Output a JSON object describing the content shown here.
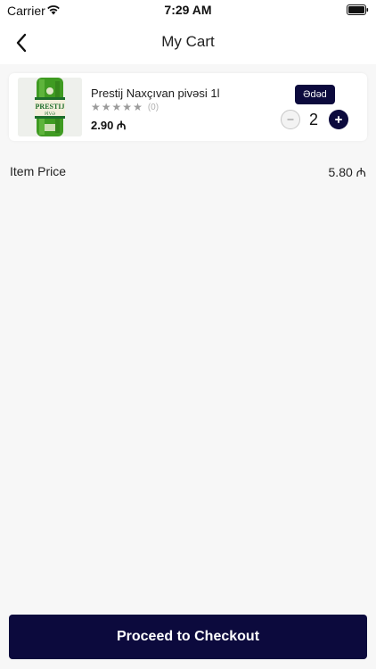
{
  "status_bar": {
    "carrier": "Carrier",
    "time": "7:29 AM"
  },
  "nav": {
    "title": "My Cart",
    "back_icon": "chevron-left-icon"
  },
  "cart": {
    "items": [
      {
        "name": "Prestij Naxçıvan pivəsi 1l",
        "rating_stars": 5,
        "rating_filled": 0,
        "rating_count": "(0)",
        "price": "2.90 ₼",
        "unit_label": "Ədəd",
        "quantity": "2",
        "image_label_line1": "PRESTIJ",
        "image_label_line2": "PİVƏ"
      }
    ]
  },
  "summary": {
    "label": "Item Price",
    "value": "5.80 ₼"
  },
  "checkout": {
    "label": "Proceed to Checkout"
  },
  "colors": {
    "primary": "#0c0a3d",
    "background": "#f7f7f7",
    "star": "#9b9b9b"
  }
}
